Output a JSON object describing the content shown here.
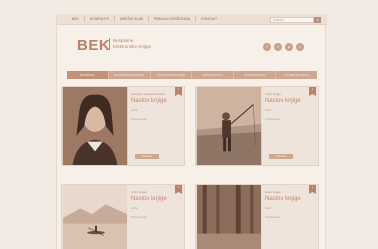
{
  "topnav": [
    "BEK",
    "Donirajte",
    "Mrežni klub",
    "Pravila korišćenja",
    "Kontakt"
  ],
  "search": {
    "placeholder": "pretraži",
    "button_icon": "⌕"
  },
  "logo": {
    "mark": "BEK",
    "line1": "Besplatne",
    "line2": "Elektronske Knjige"
  },
  "social": [
    {
      "icon": "facebook-icon",
      "glyph": "f"
    },
    {
      "icon": "twitter-icon",
      "glyph": "t"
    },
    {
      "icon": "pinterest-icon",
      "glyph": "p"
    },
    {
      "icon": "rss-icon",
      "glyph": "r"
    }
  ],
  "categories": [
    "Početna",
    "Najčitanije knjige",
    "Najnovije knjige",
    "Domaći pisci",
    "Svetski pisci",
    "Knjige za decu"
  ],
  "cards": [
    {
      "author": "Georges Jacques Danton",
      "title": "Naslov knjige",
      "meta": "Jezik",
      "meta2": "Preuzimanje",
      "button": "Preuzmi",
      "ribbon": "e"
    },
    {
      "author": "Autor knjige",
      "title": "Naslov knjige",
      "meta": "Jezik",
      "meta2": "Preuzimanje",
      "button": "Preuzmi",
      "ribbon": "e"
    },
    {
      "author": "Autor knjige",
      "title": "Naslov knjige",
      "meta": "Jezik",
      "meta2": "Preuzimanje",
      "button": "",
      "ribbon": "e"
    },
    {
      "author": "Autor knjige",
      "title": "Naslov knjige",
      "meta": "Jezik",
      "meta2": "Preuzimanje",
      "button": "",
      "ribbon": "e"
    }
  ],
  "colors": {
    "brand": "#b9826a",
    "background": "#f3ebe3",
    "nav": "#cfa68f"
  }
}
